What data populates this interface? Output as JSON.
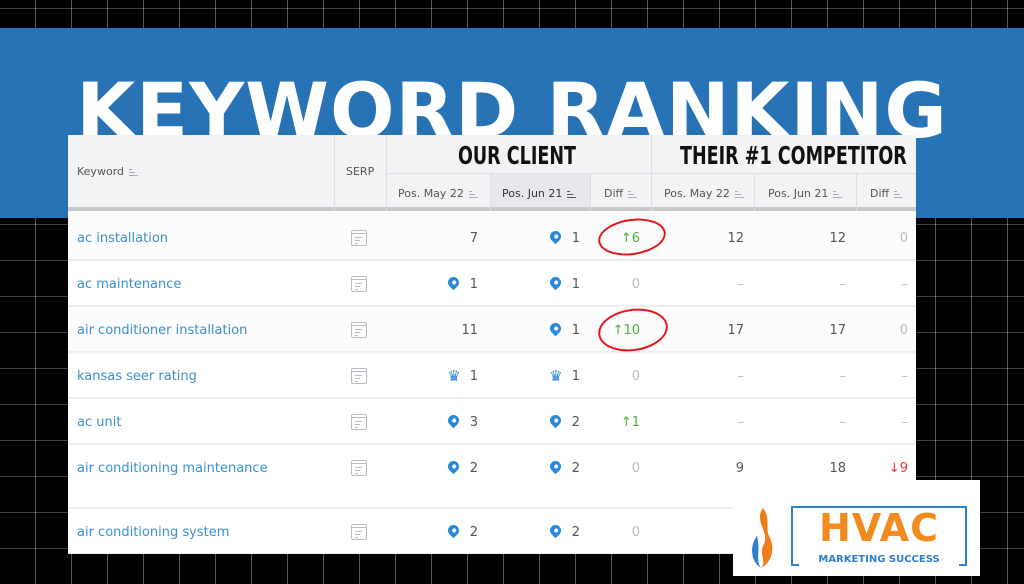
{
  "banner": {
    "title": "KEYWORD RANKING",
    "color": "#2773b5"
  },
  "table": {
    "groups": {
      "client": "OUR CLIENT",
      "competitor": "THEIR #1 COMPETITOR"
    },
    "headers": {
      "keyword": "Keyword",
      "serp": "SERP",
      "client_pos_may": "Pos. May 22",
      "client_pos_jun": "Pos. Jun 21",
      "client_diff": "Diff",
      "comp_pos_may": "Pos. May 22",
      "comp_pos_jun": "Pos. Jun 21",
      "comp_diff": "Diff"
    },
    "rows": [
      {
        "keyword": "ac installation",
        "client_may": "7",
        "client_may_icon": "",
        "client_jun": "1",
        "client_jun_icon": "pin",
        "client_diff": "↑6",
        "client_diff_dir": "up",
        "comp_may": "12",
        "comp_jun": "12",
        "comp_diff": "0",
        "comp_diff_dir": "zero",
        "highlighted": true
      },
      {
        "keyword": "ac maintenance",
        "client_may": "1",
        "client_may_icon": "pin",
        "client_jun": "1",
        "client_jun_icon": "pin",
        "client_diff": "0",
        "client_diff_dir": "zero",
        "comp_may": "–",
        "comp_jun": "–",
        "comp_diff": "–",
        "comp_diff_dir": "dash",
        "highlighted": false
      },
      {
        "keyword": "air conditioner installation",
        "client_may": "11",
        "client_may_icon": "",
        "client_jun": "1",
        "client_jun_icon": "pin",
        "client_diff": "↑10",
        "client_diff_dir": "up",
        "comp_may": "17",
        "comp_jun": "17",
        "comp_diff": "0",
        "comp_diff_dir": "zero",
        "highlighted": true
      },
      {
        "keyword": "kansas seer rating",
        "client_may": "1",
        "client_may_icon": "crown",
        "client_jun": "1",
        "client_jun_icon": "crown",
        "client_diff": "0",
        "client_diff_dir": "zero",
        "comp_may": "–",
        "comp_jun": "–",
        "comp_diff": "–",
        "comp_diff_dir": "dash",
        "highlighted": false
      },
      {
        "keyword": "ac unit",
        "client_may": "3",
        "client_may_icon": "pin",
        "client_jun": "2",
        "client_jun_icon": "pin",
        "client_diff": "↑1",
        "client_diff_dir": "up",
        "comp_may": "–",
        "comp_jun": "–",
        "comp_diff": "–",
        "comp_diff_dir": "dash",
        "highlighted": false
      },
      {
        "keyword": "air conditioning maintenance",
        "client_may": "2",
        "client_may_icon": "pin",
        "client_jun": "2",
        "client_jun_icon": "pin",
        "client_diff": "0",
        "client_diff_dir": "zero",
        "comp_may": "9",
        "comp_jun": "18",
        "comp_diff": "↓9",
        "comp_diff_dir": "down",
        "highlighted": false
      },
      {
        "keyword": "air conditioning system",
        "client_may": "2",
        "client_may_icon": "pin",
        "client_jun": "2",
        "client_jun_icon": "pin",
        "client_diff": "0",
        "client_diff_dir": "zero",
        "comp_may": "",
        "comp_jun": "",
        "comp_diff": "",
        "comp_diff_dir": "",
        "highlighted": false
      }
    ]
  },
  "logo": {
    "name": "HVAC",
    "tagline": "MARKETING SUCCESS",
    "primary_color": "#f28a1e",
    "secondary_color": "#2d7fcf"
  },
  "colors": {
    "link": "#3a8fcf",
    "up": "#4caf35",
    "down": "#e8363a",
    "annotation": "#e4161c"
  }
}
